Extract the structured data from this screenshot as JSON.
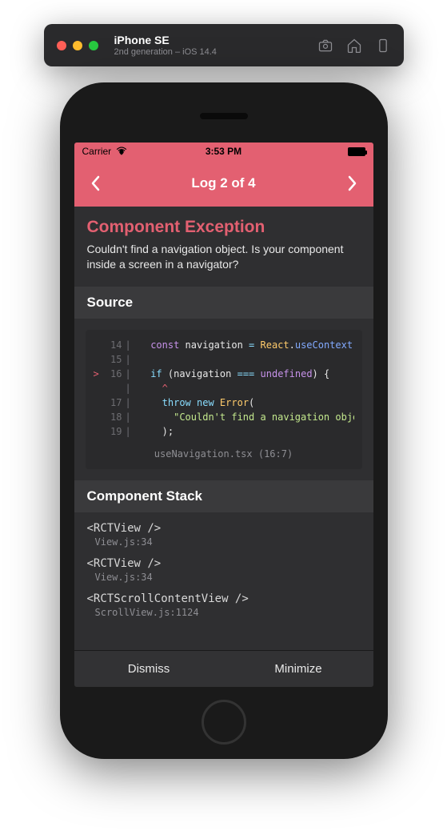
{
  "simulator": {
    "device": "iPhone SE",
    "subtitle": "2nd generation – iOS 14.4"
  },
  "statusBar": {
    "carrier": "Carrier",
    "time": "3:53 PM"
  },
  "logNav": {
    "title": "Log 2 of 4"
  },
  "error": {
    "title": "Component Exception",
    "message": "Couldn't find a navigation object. Is your component inside a screen in a navigator?"
  },
  "source": {
    "heading": "Source",
    "file": "useNavigation.tsx (16:7)",
    "lines": [
      {
        "n": "14",
        "marker": "",
        "html": "  <span class='kw'>const</span> <span class='ident'>navigation</span> <span class='op'>=</span> <span class='type'>React</span><span class='punct'>.</span><span class='func'>useContext</span><span class='punct'>(</span><span class='type'>N</span>"
      },
      {
        "n": "15",
        "marker": "",
        "html": ""
      },
      {
        "n": "16",
        "marker": ">",
        "html": "  <span class='kw2'>if</span> <span class='punct'>(</span><span class='ident'>navigation</span> <span class='op'>===</span> <span class='kw'>undefined</span><span class='punct'>)</span> <span class='punct'>{</span>"
      },
      {
        "n": "",
        "marker": "",
        "html": "    <span style='color:#e36071'>^</span>",
        "caret": true
      },
      {
        "n": "17",
        "marker": "",
        "html": "    <span class='kw2'>throw</span> <span class='kw2'>new</span> <span class='type'>Error</span><span class='punct'>(</span>"
      },
      {
        "n": "18",
        "marker": "",
        "html": "      <span class='str'>\"Couldn't find a navigation objec</span>"
      },
      {
        "n": "19",
        "marker": "",
        "html": "    <span class='punct'>);</span>"
      }
    ]
  },
  "componentStack": {
    "heading": "Component Stack",
    "items": [
      {
        "comp": "<RCTView />",
        "loc": "View.js:34"
      },
      {
        "comp": "<RCTView />",
        "loc": "View.js:34"
      },
      {
        "comp": "<RCTScrollContentView />",
        "loc": "ScrollView.js:1124"
      }
    ]
  },
  "buttons": {
    "dismiss": "Dismiss",
    "minimize": "Minimize"
  }
}
